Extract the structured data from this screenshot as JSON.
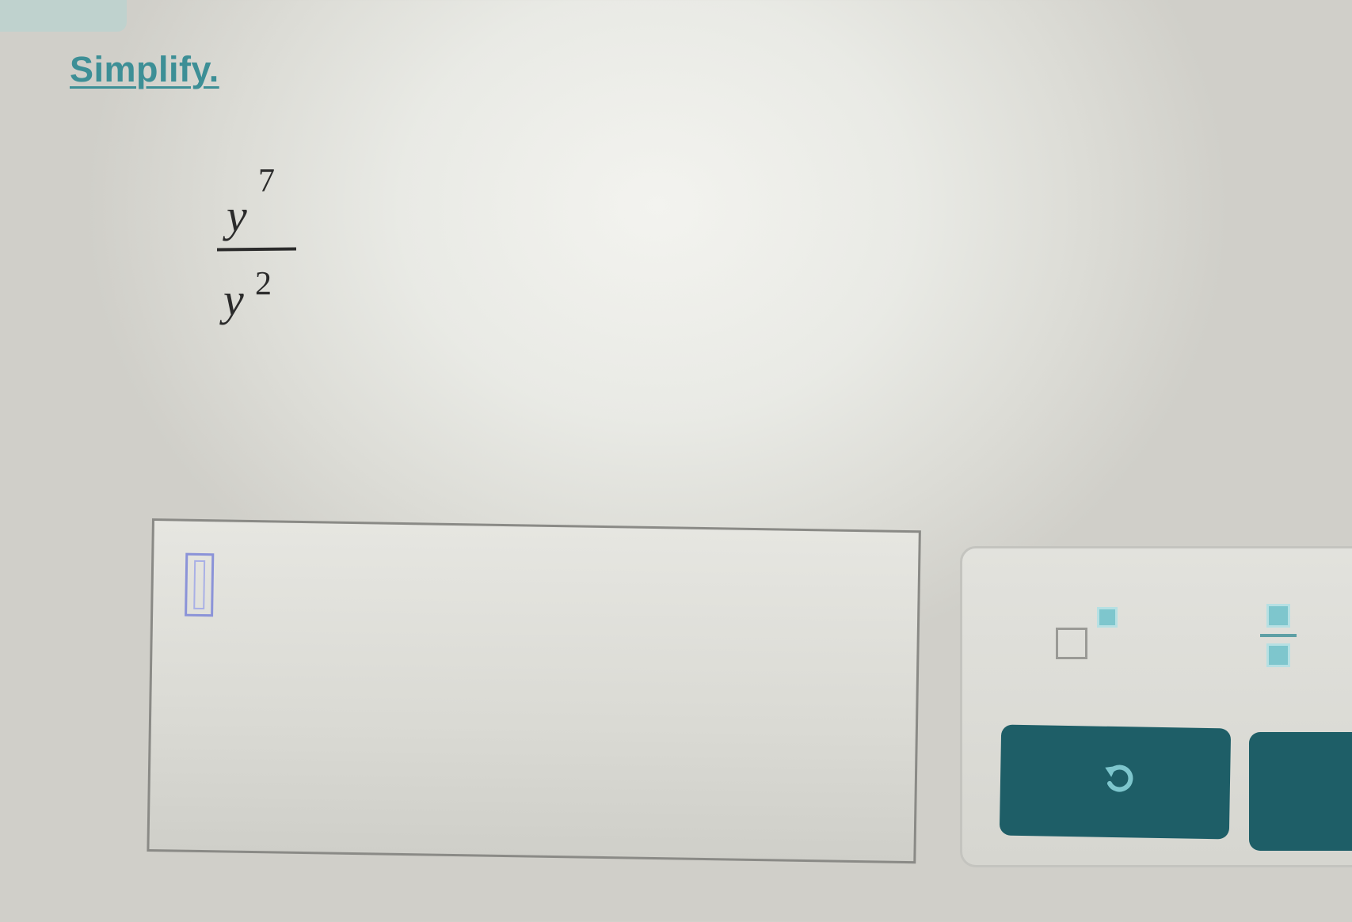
{
  "question": {
    "instruction": "Simplify.",
    "expression": {
      "numerator": {
        "base": "y",
        "exponent": "7"
      },
      "denominator": {
        "base": "y",
        "exponent": "2"
      }
    }
  },
  "answer": {
    "value": ""
  },
  "keypad": {
    "keys": [
      {
        "name": "exponent-key",
        "icon": "superscript-template-icon"
      },
      {
        "name": "fraction-key",
        "icon": "fraction-template-icon"
      }
    ],
    "actions": [
      {
        "name": "undo-button",
        "icon": "undo-icon"
      }
    ]
  },
  "colors": {
    "accent": "#3d8f96",
    "button": "#1e5e67",
    "template_fill": "#7ec6cd"
  }
}
